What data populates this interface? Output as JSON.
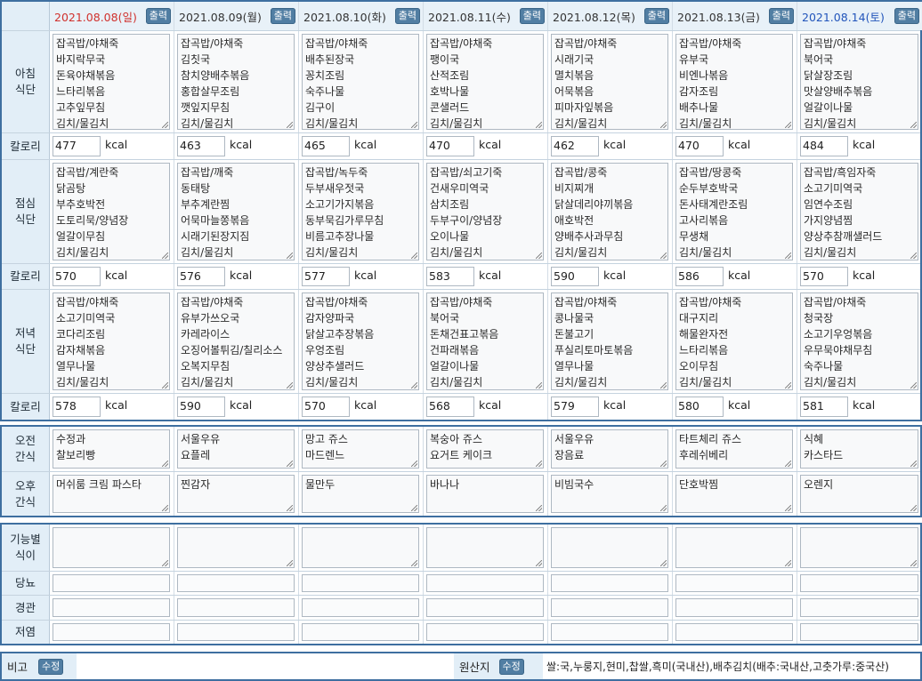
{
  "header": {
    "dates": [
      {
        "label": "2021.08.08(일)",
        "color": "#d0312d"
      },
      {
        "label": "2021.08.09(월)",
        "color": "#333333"
      },
      {
        "label": "2021.08.10(화)",
        "color": "#333333"
      },
      {
        "label": "2021.08.11(수)",
        "color": "#333333"
      },
      {
        "label": "2021.08.12(목)",
        "color": "#333333"
      },
      {
        "label": "2021.08.13(금)",
        "color": "#333333"
      },
      {
        "label": "2021.08.14(토)",
        "color": "#2255bb"
      }
    ],
    "print_label": "출력"
  },
  "labels": {
    "breakfast": "아침\n식단",
    "lunch": "점심\n식단",
    "dinner": "저녁\n식단",
    "calorie": "칼로리",
    "am_snack": "오전\n간식",
    "pm_snack": "오후\n간식",
    "functional": "기능별\n식이",
    "diabetes": "당뇨",
    "tube": "경관",
    "low_salt": "저염",
    "note": "비고",
    "origin": "원산지",
    "edit": "수정",
    "kcal": "kcal"
  },
  "breakfast": [
    "잡곡밥/야채죽\n바지락무국\n돈육야채볶음\n느타리볶음\n고추잎무침\n김치/물김치",
    "잡곡밥/야채죽\n김칫국\n참치양배추볶음\n홍합살무조림\n깻잎지무침\n김치/물김치",
    "잡곡밥/야채죽\n배추된장국\n꽁치조림\n숙주나물\n김구이\n김치/물김치",
    "잡곡밥/야채죽\n팽이국\n산적조림\n호박나물\n콘샐러드\n김치/물김치",
    "잡곡밥/야채죽\n시래기국\n멸치볶음\n어묵볶음\n피마자잎볶음\n김치/물김치",
    "잡곡밥/야채죽\n유부국\n비엔나볶음\n감자조림\n배추나물\n김치/물김치",
    "잡곡밥/야채죽\n북어국\n닭살장조림\n맛살양배추볶음\n얼갈이나물\n김치/물김치"
  ],
  "breakfast_kcal": [
    "477",
    "463",
    "465",
    "470",
    "462",
    "470",
    "484"
  ],
  "lunch": [
    "잡곡밥/계란죽\n닭곰탕\n부추호박전\n도토리묵/양념장\n얼갈이무침\n김치/물김치",
    "잡곡밥/깨죽\n동태탕\n부추계란찜\n어묵마늘쫑볶음\n시래기된장지짐\n김치/물김치",
    "잡곡밥/녹두죽\n두부새우젓국\n소고기가지볶음\n동부묵김가루무침\n비름고추장나물\n김치/물김치",
    "잡곡밥/쇠고기죽\n건새우미역국\n삼치조림\n두부구이/양념장\n오이나물\n김치/물김치",
    "잡곡밥/콩죽\n비지찌개\n닭살데리야끼볶음\n애호박전\n양배추사과무침\n김치/물김치",
    "잡곡밥/땅콩죽\n순두부호박국\n돈사태계란조림\n고사리볶음\n무생채\n김치/물김치",
    "잡곡밥/흑임자죽\n소고기미역국\n임연수조림\n가지양념찜\n양상추참깨샐러드\n김치/물김치"
  ],
  "lunch_kcal": [
    "570",
    "576",
    "577",
    "583",
    "590",
    "586",
    "570"
  ],
  "dinner": [
    "잡곡밥/야채죽\n소고기미역국\n코다리조림\n감자채볶음\n열무나물\n김치/물김치",
    "잡곡밥/야채죽\n유부가쓰오국\n카레라이스\n오징어볼튀김/칠리소스\n오복지무침\n김치/물김치",
    "잡곡밥/야채죽\n감자양파국\n닭살고추장볶음\n우엉조림\n양상추샐러드\n김치/물김치",
    "잡곡밥/야채죽\n북어국\n돈채건표고볶음\n건파래볶음\n얼갈이나물\n김치/물김치",
    "잡곡밥/야채죽\n콩나물국\n돈불고기\n푸실리토마토볶음\n열무나물\n김치/물김치",
    "잡곡밥/야채죽\n대구지리\n해물완자전\n느타리볶음\n오이무침\n김치/물김치",
    "잡곡밥/야채죽\n청국장\n소고기우엉볶음\n우무묵야채무침\n숙주나물\n김치/물김치"
  ],
  "dinner_kcal": [
    "578",
    "590",
    "570",
    "568",
    "579",
    "580",
    "581"
  ],
  "am_snack": [
    "수정과\n찰보리빵",
    "서울우유\n요플레",
    "망고 쥬스\n마드렌느",
    "복숭아 쥬스\n요거트 케이크",
    "서울우유\n장음료",
    "타트체리 쥬스\n후레쉬베리",
    "식혜\n카스타드"
  ],
  "pm_snack": [
    "머쉬룸 크림 파스타",
    "찐감자",
    "물만두",
    "바나나",
    "비빔국수",
    "단호박찜",
    "오렌지"
  ],
  "origin_text": "쌀:국,누룽지,현미,찹쌀,흑미(국내산),배추김치(배추:국내산,고춧가루:중국산)"
}
